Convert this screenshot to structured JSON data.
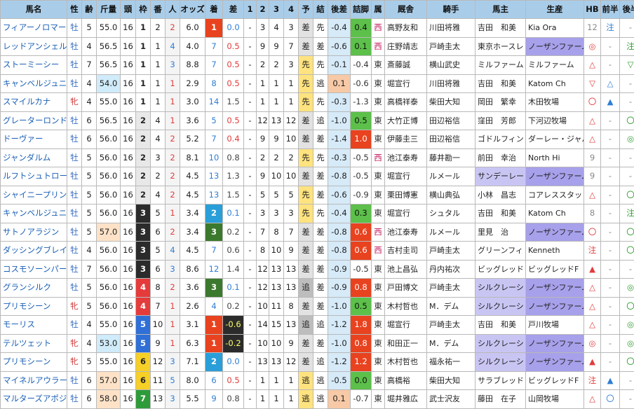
{
  "colors": {
    "header_bg": "#a9cde9",
    "frame": [
      "#ffffff",
      "#ffffff",
      "#e8e8e8",
      "#2b2b2b",
      "#e53b3b",
      "#2f6fd6",
      "#f6cf27",
      "#2e9b3a"
    ],
    "frame_text": [
      "#222",
      "#222",
      "#222",
      "#ffffff",
      "#ffffff",
      "#ffffff",
      "#222",
      "#ffffff"
    ],
    "rank1_bg": "#e8421f",
    "rank2_bg": "#2a9ed8",
    "rank3_bg": "#3b7a2e",
    "rank_text": "#ffffff",
    "tenkai_bg": "#e2e2e2",
    "tenkai_sen_bg": "#ffe37f",
    "tenkai_oi_bg": "#bdbdbd",
    "sashi_col_bg": "#d9f0c9",
    "tsume_col_bg": "#d9f0c9",
    "owner_hl_bg": "#c9c5f3",
    "breeder_hl_bg": "#a7a0ea",
    "tsume_hl_bg": "#f7c9a6",
    "sa_dark_bg": "#2b2b2b",
    "sa_dark_text": "#ffff66",
    "mark_red": "#e23b3b",
    "mark_blue": "#2f7ed4",
    "mark_green": "#2e9b2e"
  },
  "headers": {
    "name": "馬名",
    "sex": "性",
    "age": "齢",
    "weight": "斤量",
    "heads": "頭",
    "frame": "枠",
    "number": "番",
    "popularity": "人",
    "odds": "オッズ",
    "rank": "着",
    "diff": "差",
    "c1": "1",
    "c2": "2",
    "c3": "3",
    "c4": "4",
    "pred": "予",
    "result": "結",
    "late_diff": "後差",
    "tsume": "詰脚",
    "region": "属",
    "stable": "厩舎",
    "jockey": "騎手",
    "owner": "馬主",
    "breeder": "生産",
    "hb": "HB",
    "zenhan": "前半",
    "kohan": "後半"
  },
  "rows": [
    {
      "name": "フィアーノロマーノ",
      "sex": "牡",
      "age": "5",
      "weight": "55.0",
      "heads": "16",
      "frame": "1",
      "number": "2",
      "pop": "2",
      "odds": "6.0",
      "rank": "1",
      "diff": "0.0",
      "c1": "-",
      "c2": "3",
      "c3": "4",
      "c4": "3",
      "pred": "差",
      "result": "先",
      "late": "-0.4",
      "tsume": "0.4",
      "region": "西",
      "stable": "高野友和",
      "jockey": "川田将雅",
      "owner": "吉田　和美",
      "breeder": "Kia Ora",
      "hb": "12",
      "zen": "注",
      "ko": "-"
    },
    {
      "name": "レッドアンシェル",
      "sex": "牡",
      "age": "4",
      "weight": "56.5",
      "heads": "16",
      "frame": "1",
      "number": "1",
      "pop": "4",
      "odds": "4.0",
      "rank": "7",
      "diff": "0.5",
      "c1": "-",
      "c2": "9",
      "c3": "9",
      "c4": "7",
      "pred": "差",
      "result": "差",
      "late": "-0.6",
      "tsume": "0.1",
      "region": "西",
      "stable": "庄野靖志",
      "jockey": "戸崎圭太",
      "owner": "東京ホースレ",
      "breeder": "ノーザンファーム",
      "hb": "◎",
      "zen": "-",
      "ko": "注"
    },
    {
      "name": "ストーミーシー",
      "sex": "牡",
      "age": "7",
      "weight": "56.5",
      "heads": "16",
      "frame": "1",
      "number": "1",
      "pop": "3",
      "odds": "8.8",
      "rank": "7",
      "diff": "0.5",
      "c1": "-",
      "c2": "2",
      "c3": "2",
      "c4": "3",
      "pred": "先",
      "result": "先",
      "late": "-0.1",
      "tsume": "-0.4",
      "region": "東",
      "stable": "斎藤誠",
      "jockey": "横山武史",
      "owner": "ミルファーム",
      "breeder": "ミルファーム",
      "hb": "△",
      "zen": "-",
      "ko": "▽"
    },
    {
      "name": "キャンベルジュニア",
      "sex": "牡",
      "age": "4",
      "weight": "54.0",
      "heads": "16",
      "frame": "1",
      "number": "1",
      "pop": "1",
      "odds": "2.9",
      "rank": "8",
      "diff": "0.5",
      "c1": "-",
      "c2": "1",
      "c3": "1",
      "c4": "1",
      "pred": "先",
      "result": "逃",
      "late": "0.1",
      "tsume": "-0.6",
      "region": "東",
      "stable": "堀宣行",
      "jockey": "川田将雅",
      "owner": "吉田　和美",
      "breeder": "Katom Ch",
      "hb": "▽",
      "zen": "△",
      "ko": "-"
    },
    {
      "name": "スマイルカナ",
      "sex": "牝",
      "age": "4",
      "weight": "55.0",
      "heads": "16",
      "frame": "1",
      "number": "1",
      "pop": "1",
      "odds": "3.0",
      "rank": "14",
      "diff": "1.5",
      "c1": "-",
      "c2": "1",
      "c3": "1",
      "c4": "1",
      "pred": "先",
      "result": "先",
      "late": "-0.3",
      "tsume": "-1.3",
      "region": "東",
      "stable": "高橋祥泰",
      "jockey": "柴田大知",
      "owner": "岡田　繁幸",
      "breeder": "木田牧場",
      "hb": "〇",
      "zen": "▲",
      "ko": "-"
    },
    {
      "name": "グレーターロンドン",
      "sex": "牡",
      "age": "6",
      "weight": "56.5",
      "heads": "16",
      "frame": "2",
      "number": "4",
      "pop": "1",
      "odds": "3.6",
      "rank": "5",
      "diff": "0.5",
      "c1": "-",
      "c2": "12",
      "c3": "13",
      "c4": "12",
      "pred": "差",
      "result": "追",
      "late": "-1.0",
      "tsume": "0.5",
      "region": "東",
      "stable": "大竹正博",
      "jockey": "田辺裕信",
      "owner": "窪田　芳郎",
      "breeder": "下河辺牧場",
      "hb": "△",
      "zen": "-",
      "ko": "〇"
    },
    {
      "name": "ドーヴァー",
      "sex": "牡",
      "age": "6",
      "weight": "56.0",
      "heads": "16",
      "frame": "2",
      "number": "4",
      "pop": "2",
      "odds": "5.2",
      "rank": "7",
      "diff": "0.4",
      "c1": "-",
      "c2": "9",
      "c3": "9",
      "c4": "10",
      "pred": "差",
      "result": "差",
      "late": "-1.4",
      "tsume": "1.0",
      "region": "東",
      "stable": "伊藤圭三",
      "jockey": "田辺裕信",
      "owner": "ゴドルフィン",
      "breeder": "ダーレー・ジャパ",
      "hb": "△",
      "zen": "-",
      "ko": "◎"
    },
    {
      "name": "ジャンダルム",
      "sex": "牡",
      "age": "5",
      "weight": "56.0",
      "heads": "16",
      "frame": "2",
      "number": "3",
      "pop": "2",
      "odds": "8.1",
      "rank": "10",
      "diff": "0.8",
      "c1": "-",
      "c2": "2",
      "c3": "2",
      "c4": "2",
      "pred": "先",
      "result": "先",
      "late": "-0.3",
      "tsume": "-0.5",
      "region": "西",
      "stable": "池江泰寿",
      "jockey": "藤井勘一",
      "owner": "前田　幸治",
      "breeder": "North Hi",
      "hb": "9",
      "zen": "-",
      "ko": "-"
    },
    {
      "name": "ルフトシュトローム",
      "sex": "牡",
      "age": "5",
      "weight": "56.0",
      "heads": "16",
      "frame": "2",
      "number": "2",
      "pop": "2",
      "odds": "4.5",
      "rank": "13",
      "diff": "1.3",
      "c1": "-",
      "c2": "9",
      "c3": "10",
      "c4": "10",
      "pred": "差",
      "result": "差",
      "late": "-0.8",
      "tsume": "-0.5",
      "region": "東",
      "stable": "堀宣行",
      "jockey": "ルメール",
      "owner": "サンデーレー",
      "breeder": "ノーザンファーム",
      "hb": "9",
      "zen": "-",
      "ko": "-"
    },
    {
      "name": "シャイニープリンス",
      "sex": "牡",
      "age": "5",
      "weight": "56.0",
      "heads": "16",
      "frame": "2",
      "number": "4",
      "pop": "2",
      "odds": "4.5",
      "rank": "13",
      "diff": "1.5",
      "c1": "-",
      "c2": "5",
      "c3": "5",
      "c4": "5",
      "pred": "先",
      "result": "差",
      "late": "-0.6",
      "tsume": "-0.9",
      "region": "東",
      "stable": "栗田博憲",
      "jockey": "横山典弘",
      "owner": "小林　昌志",
      "breeder": "コアレススタッド",
      "hb": "△",
      "zen": "-",
      "ko": "〇"
    },
    {
      "name": "キャンベルジュニア",
      "sex": "牡",
      "age": "5",
      "weight": "56.0",
      "heads": "16",
      "frame": "3",
      "number": "5",
      "pop": "1",
      "odds": "3.4",
      "rank": "2",
      "diff": "0.1",
      "c1": "-",
      "c2": "3",
      "c3": "3",
      "c4": "3",
      "pred": "先",
      "result": "先",
      "late": "-0.4",
      "tsume": "0.3",
      "region": "東",
      "stable": "堀宣行",
      "jockey": "シュタル",
      "owner": "吉田　和美",
      "breeder": "Katom Ch",
      "hb": "8",
      "zen": "-",
      "ko": "注"
    },
    {
      "name": "サトノアラジン",
      "sex": "牡",
      "age": "5",
      "weight": "57.0",
      "heads": "16",
      "frame": "3",
      "number": "6",
      "pop": "2",
      "odds": "3.4",
      "rank": "3",
      "diff": "0.2",
      "c1": "-",
      "c2": "7",
      "c3": "8",
      "c4": "7",
      "pred": "差",
      "result": "差",
      "late": "-0.8",
      "tsume": "0.6",
      "region": "西",
      "stable": "池江泰寿",
      "jockey": "ルメール",
      "owner": "里見　治",
      "breeder": "ノーザンファーム",
      "hb": "〇",
      "zen": "-",
      "ko": "〇"
    },
    {
      "name": "ダッシングブレイズ",
      "sex": "牡",
      "age": "4",
      "weight": "56.0",
      "heads": "16",
      "frame": "3",
      "number": "5",
      "pop": "4",
      "odds": "4.5",
      "rank": "7",
      "diff": "0.6",
      "c1": "-",
      "c2": "8",
      "c3": "10",
      "c4": "9",
      "pred": "差",
      "result": "差",
      "late": "-0.8",
      "tsume": "0.6",
      "region": "西",
      "stable": "吉村圭司",
      "jockey": "戸崎圭太",
      "owner": "グリーンフィ",
      "breeder": "Kenneth",
      "hb": "注",
      "zen": "-",
      "ko": "〇"
    },
    {
      "name": "コスモソーンパーク",
      "sex": "牡",
      "age": "7",
      "weight": "56.0",
      "heads": "16",
      "frame": "3",
      "number": "6",
      "pop": "3",
      "odds": "8.6",
      "rank": "12",
      "diff": "1.4",
      "c1": "-",
      "c2": "12",
      "c3": "13",
      "c4": "13",
      "pred": "差",
      "result": "差",
      "late": "-0.9",
      "tsume": "-0.5",
      "region": "東",
      "stable": "池上昌弘",
      "jockey": "丹内祐次",
      "owner": "ビッグレッド",
      "breeder": "ビッグレッドF",
      "hb": "▲",
      "zen": "-",
      "ko": "-"
    },
    {
      "name": "グランシルク",
      "sex": "牡",
      "age": "5",
      "weight": "56.0",
      "heads": "16",
      "frame": "4",
      "number": "8",
      "pop": "2",
      "odds": "3.6",
      "rank": "3",
      "diff": "0.1",
      "c1": "-",
      "c2": "12",
      "c3": "13",
      "c4": "13",
      "pred": "追",
      "result": "差",
      "late": "-0.9",
      "tsume": "0.8",
      "region": "東",
      "stable": "戸田博文",
      "jockey": "戸崎圭太",
      "owner": "シルクレーシ",
      "breeder": "ノーザンファーム",
      "hb": "△",
      "zen": "-",
      "ko": "◎"
    },
    {
      "name": "プリモシーン",
      "sex": "牝",
      "age": "5",
      "weight": "56.0",
      "heads": "16",
      "frame": "4",
      "number": "7",
      "pop": "1",
      "odds": "2.6",
      "rank": "4",
      "diff": "0.2",
      "c1": "-",
      "c2": "10",
      "c3": "11",
      "c4": "8",
      "pred": "差",
      "result": "差",
      "late": "-1.0",
      "tsume": "0.5",
      "region": "東",
      "stable": "木村哲也",
      "jockey": "M．デム",
      "owner": "シルクレーシ",
      "breeder": "ノーザンファーム",
      "hb": "△",
      "zen": "-",
      "ko": "〇"
    },
    {
      "name": "モーリス",
      "sex": "牡",
      "age": "4",
      "weight": "55.0",
      "heads": "16",
      "frame": "5",
      "number": "10",
      "pop": "1",
      "odds": "3.1",
      "rank": "1",
      "diff": "-0.6",
      "c1": "-",
      "c2": "14",
      "c3": "15",
      "c4": "13",
      "pred": "追",
      "result": "追",
      "late": "-1.2",
      "tsume": "1.8",
      "region": "東",
      "stable": "堀宣行",
      "jockey": "戸崎圭太",
      "owner": "吉田　和美",
      "breeder": "戸川牧場",
      "hb": "△",
      "zen": "-",
      "ko": "◎"
    },
    {
      "name": "テルツェット",
      "sex": "牝",
      "age": "4",
      "weight": "53.0",
      "heads": "16",
      "frame": "5",
      "number": "9",
      "pop": "1",
      "odds": "6.3",
      "rank": "1",
      "diff": "-0.2",
      "c1": "-",
      "c2": "10",
      "c3": "10",
      "c4": "9",
      "pred": "差",
      "result": "差",
      "late": "-1.0",
      "tsume": "0.8",
      "region": "東",
      "stable": "和田正一",
      "jockey": "M．デム",
      "owner": "シルクレーシ",
      "breeder": "ノーザンファーム",
      "hb": "◎",
      "zen": "-",
      "ko": "◎"
    },
    {
      "name": "プリモシーン",
      "sex": "牝",
      "age": "5",
      "weight": "55.0",
      "heads": "16",
      "frame": "6",
      "number": "12",
      "pop": "3",
      "odds": "7.1",
      "rank": "2",
      "diff": "0.0",
      "c1": "-",
      "c2": "13",
      "c3": "13",
      "c4": "12",
      "pred": "差",
      "result": "追",
      "late": "-1.2",
      "tsume": "1.2",
      "region": "東",
      "stable": "木村哲也",
      "jockey": "福永祐一",
      "owner": "シルクレーシ",
      "breeder": "ノーザンファーム",
      "hb": "▲",
      "zen": "-",
      "ko": "〇"
    },
    {
      "name": "マイネルアウラート",
      "sex": "牡",
      "age": "6",
      "weight": "57.0",
      "heads": "16",
      "frame": "6",
      "number": "11",
      "pop": "5",
      "odds": "8.0",
      "rank": "6",
      "diff": "0.5",
      "c1": "-",
      "c2": "1",
      "c3": "1",
      "c4": "1",
      "pred": "逃",
      "result": "逃",
      "late": "-0.5",
      "tsume": "0.0",
      "region": "東",
      "stable": "高橋裕",
      "jockey": "柴田大知",
      "owner": "サラブレッド",
      "breeder": "ビッグレッドF",
      "hb": "注",
      "zen": "▲",
      "ko": "-"
    },
    {
      "name": "マルターズアポジー",
      "sex": "牡",
      "age": "6",
      "weight": "58.0",
      "heads": "16",
      "frame": "7",
      "number": "13",
      "pop": "3",
      "odds": "5.5",
      "rank": "9",
      "diff": "0.8",
      "c1": "-",
      "c2": "1",
      "c3": "1",
      "c4": "1",
      "pred": "逃",
      "result": "逃",
      "late": "0.1",
      "tsume": "-0.7",
      "region": "東",
      "stable": "堀井雅広",
      "jockey": "武士沢友",
      "owner": "藤田　在子",
      "breeder": "山岡牧場",
      "hb": "△",
      "zen": "〇",
      "ko": "-"
    }
  ]
}
